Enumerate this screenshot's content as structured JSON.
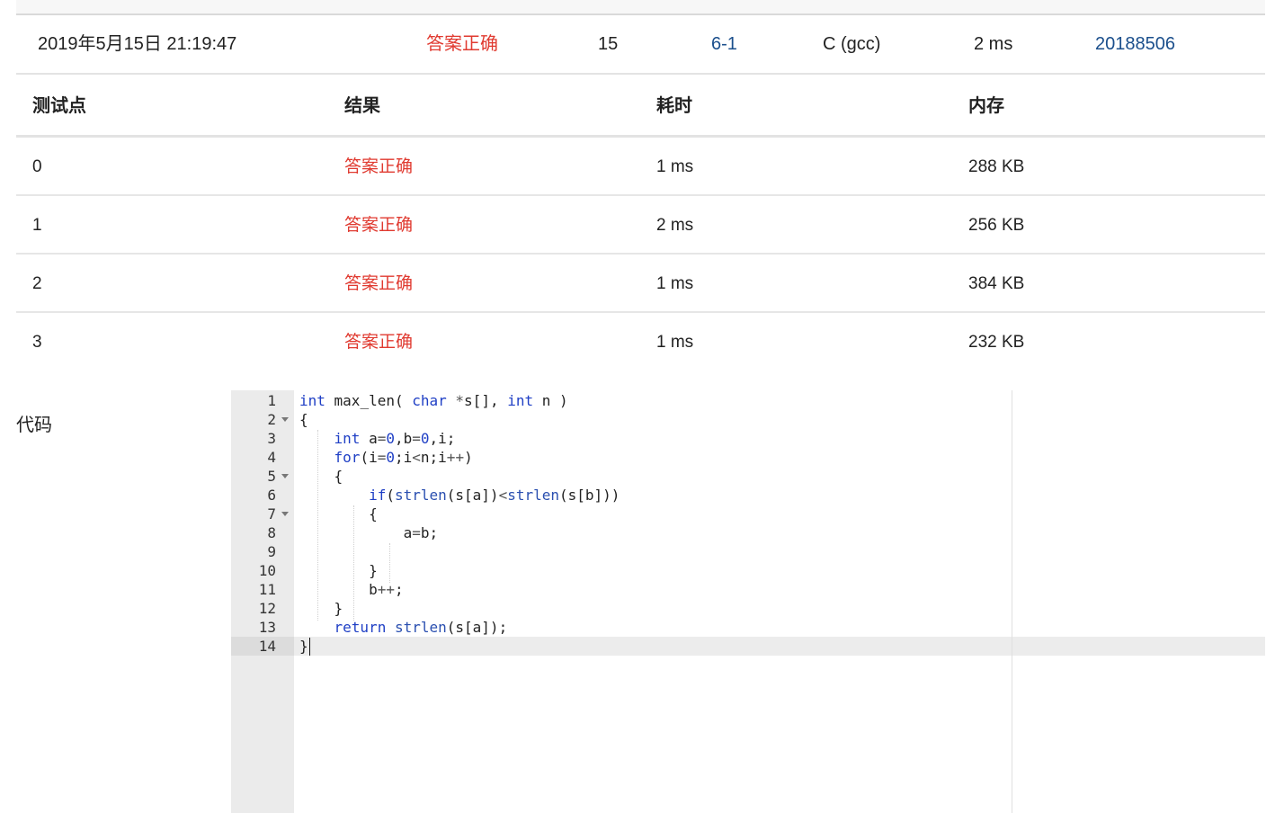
{
  "submission": {
    "time": "2019年5月15日 21:19:47",
    "status": "答案正确",
    "score": "15",
    "problem": "6-1",
    "compiler": "C (gcc)",
    "runtime": "2 ms",
    "user": "20188506"
  },
  "results_table": {
    "headers": [
      "测试点",
      "结果",
      "耗时",
      "内存"
    ],
    "rows": [
      [
        "0",
        "答案正确",
        "1 ms",
        "288 KB"
      ],
      [
        "1",
        "答案正确",
        "2 ms",
        "256 KB"
      ],
      [
        "2",
        "答案正确",
        "1 ms",
        "384 KB"
      ],
      [
        "3",
        "答案正确",
        "1 ms",
        "232 KB"
      ]
    ]
  },
  "code_section": {
    "label": "代码",
    "active_line": 14,
    "fold_lines": [
      2,
      5,
      7
    ],
    "lines": [
      "int max_len( char *s[], int n )",
      "{",
      "    int a=0,b=0,i;",
      "    for(i=0;i<n;i++)",
      "    {",
      "        if(strlen(s[a])<strlen(s[b]))",
      "        {",
      "            a=b;",
      "",
      "        }",
      "        b++;",
      "    }",
      "    return strlen(s[a]);",
      "}"
    ]
  },
  "colors": {
    "status_red": "#e03a30",
    "link_blue": "#1b4f8c",
    "keyword_blue": "#1f3fc5"
  }
}
